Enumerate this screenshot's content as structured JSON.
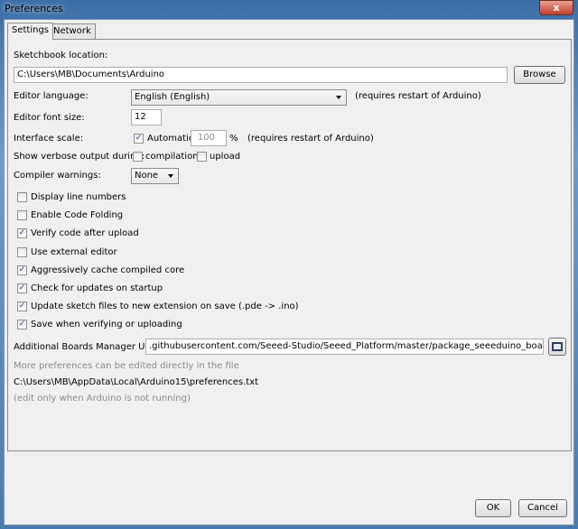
{
  "window": {
    "title": "Preferences",
    "close_label": "x"
  },
  "tabs": [
    {
      "label": "Settings",
      "active": true
    },
    {
      "label": "Network",
      "active": false
    }
  ],
  "sketchbook": {
    "label": "Sketchbook location:",
    "value": "C:\\Users\\MB\\Documents\\Arduino",
    "browse_label": "Browse"
  },
  "language": {
    "label": "Editor language:",
    "value": "English (English)",
    "note": "(requires restart of Arduino)"
  },
  "font_size": {
    "label": "Editor font size:",
    "value": "12"
  },
  "scale": {
    "label": "Interface scale:",
    "automatic_label": "Automatic",
    "automatic_checked": true,
    "value": "100",
    "unit": "%",
    "note": "(requires restart of Arduino)"
  },
  "verbose": {
    "label": "Show verbose output during:",
    "compilation_label": "compilation",
    "compilation_checked": false,
    "upload_label": "upload",
    "upload_checked": false
  },
  "warnings": {
    "label": "Compiler warnings:",
    "value": "None"
  },
  "options": [
    {
      "label": "Display line numbers",
      "checked": false
    },
    {
      "label": "Enable Code Folding",
      "checked": false
    },
    {
      "label": "Verify code after upload",
      "checked": true
    },
    {
      "label": "Use external editor",
      "checked": false
    },
    {
      "label": "Aggressively cache compiled core",
      "checked": true
    },
    {
      "label": "Check for updates on startup",
      "checked": true
    },
    {
      "label": "Update sketch files to new extension on save (.pde -> .ino)",
      "checked": true
    },
    {
      "label": "Save when verifying or uploading",
      "checked": true
    }
  ],
  "boards": {
    "label": "Additional Boards Manager URLs:",
    "value": ".githubusercontent.com/Seeed-Studio/Seeed_Platform/master/package_seeeduino_boards_index.json"
  },
  "footer": {
    "more_text": "More preferences can be edited directly in the file",
    "path": "C:\\Users\\MB\\AppData\\Local\\Arduino15\\preferences.txt",
    "edit_note": "(edit only when Arduino is not running)"
  },
  "buttons": {
    "ok": "OK",
    "cancel": "Cancel"
  }
}
